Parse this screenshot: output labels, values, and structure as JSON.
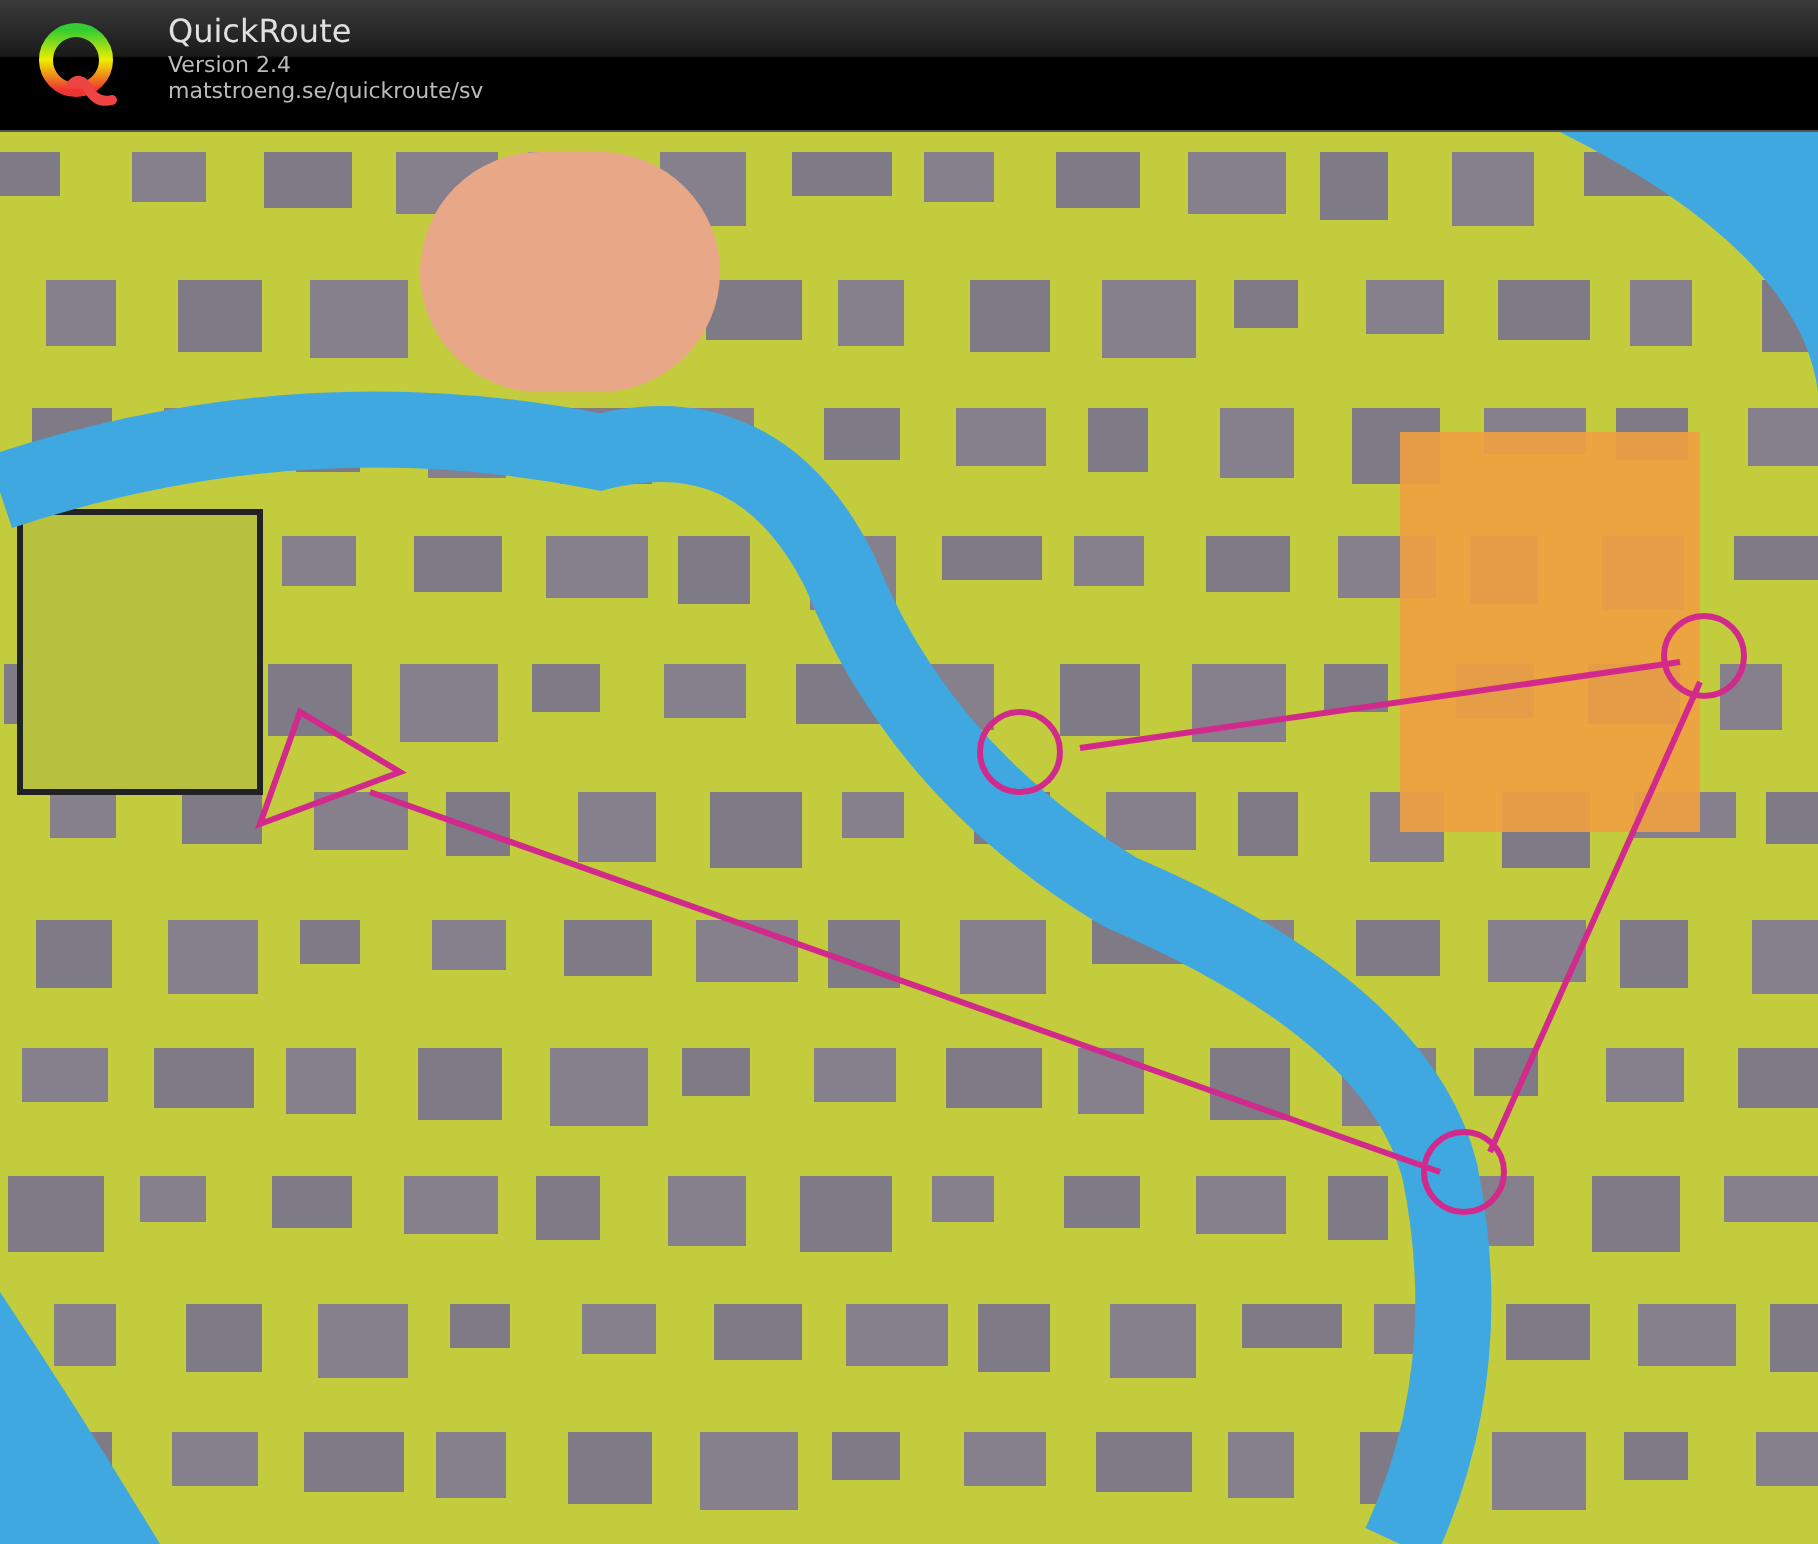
{
  "header": {
    "title": "QuickRoute",
    "version": "Version 2.4",
    "url": "matstroeng.se/quickroute/sv"
  }
}
